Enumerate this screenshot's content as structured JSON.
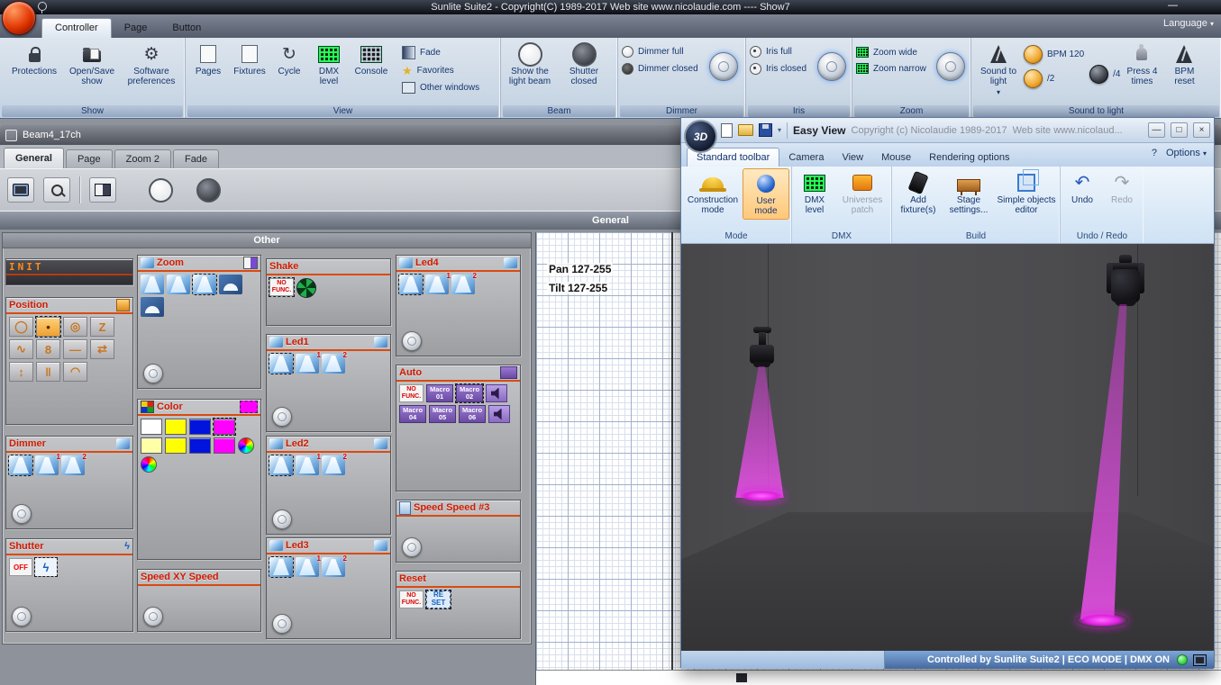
{
  "icons": {
    "minimize": "—",
    "maximize": "□",
    "close": "×",
    "gear": "⚙",
    "cycle": "↻",
    "star": "★",
    "undo_arrow": "↶",
    "redo_arrow": "↷",
    "chevron": "▾",
    "help": "?"
  },
  "colors": {
    "accent_magenta": "#ff00ff",
    "beam_magenta": "#e020e0",
    "status_green": "#2ecc3e"
  },
  "titlebar": {
    "title": "Sunlite Suite2 - Copyright(C) 1989-2017    Web site www.nicolaudie.com ---- Show7"
  },
  "ribbon": {
    "tabs": [
      {
        "label": "Controller"
      },
      {
        "label": "Page"
      },
      {
        "label": "Button"
      }
    ],
    "language": "Language",
    "groups": {
      "show": {
        "label": "Show",
        "protections": "Protections",
        "open_save": "Open/Save show",
        "preferences": "Software preferences"
      },
      "view": {
        "label": "View",
        "pages": "Pages",
        "fixtures": "Fixtures",
        "cycle": "Cycle",
        "dmx_level": "DMX level",
        "console": "Console",
        "fade": "Fade",
        "favorites": "Favorites",
        "other_windows": "Other windows"
      },
      "beam": {
        "label": "Beam",
        "show_beam": "Show the light beam",
        "shutter_closed": "Shutter closed"
      },
      "dimmer": {
        "label": "Dimmer",
        "full": "Dimmer full",
        "closed": "Dimmer closed"
      },
      "iris": {
        "label": "Iris",
        "full": "Iris full",
        "closed": "Iris closed"
      },
      "zoom": {
        "label": "Zoom",
        "wide": "Zoom wide",
        "narrow": "Zoom narrow"
      },
      "sound": {
        "label": "Sound to light",
        "main": "Sound to light",
        "bpm": "BPM 120",
        "div2": "/2",
        "div4": "/4",
        "press": "Press 4 times",
        "reset": "BPM reset"
      }
    }
  },
  "beam_window": {
    "title": "Beam4_17ch",
    "tabs": [
      {
        "label": "General"
      },
      {
        "label": "Page"
      },
      {
        "label": "Zoom 2"
      },
      {
        "label": "Fade"
      }
    ],
    "section": "General",
    "panel": "Other",
    "groups": {
      "init": {
        "title": "INIT"
      },
      "position": {
        "title": "Position",
        "icons": [
          {
            "type": "glyphbtn",
            "char": "◯",
            "name": "circle-pattern-icon"
          },
          {
            "type": "glyphbtn",
            "char": "•",
            "sel": true,
            "name": "center-pattern-icon"
          },
          {
            "type": "glyphbtn",
            "char": "◎",
            "name": "spiral-pattern-icon"
          },
          {
            "type": "glyphbtn",
            "char": "Z",
            "name": "zigzag-pattern-icon"
          },
          {
            "type": "glyphbtn",
            "char": "∿",
            "name": "wave-pattern-icon"
          },
          {
            "type": "glyphbtn",
            "char": "8",
            "name": "eight-pattern-icon"
          },
          {
            "type": "glyphbtn",
            "char": "—",
            "name": "line-pattern-icon"
          },
          {
            "type": "glyphbtn",
            "char": "⇄",
            "name": "pan-sweep-pattern-icon"
          },
          {
            "type": "glyphbtn",
            "char": "↕",
            "name": "tilt-sweep-pattern-icon"
          },
          {
            "type": "glyphbtn",
            "char": "‖",
            "name": "pause-pattern-icon"
          },
          {
            "type": "glyphbtn",
            "char": "◠",
            "name": "arc-pattern-icon"
          }
        ]
      },
      "dimmer": {
        "title": "Dimmer",
        "icons": [
          {
            "type": "beam",
            "sel": true
          },
          {
            "type": "beam",
            "badge": "1"
          },
          {
            "type": "beam",
            "badge": "2"
          }
        ]
      },
      "shutter": {
        "title": "Shutter",
        "icons": [
          {
            "type": "off",
            "label": "OFF"
          },
          {
            "type": "bolt",
            "char": "ϟ",
            "sel": true
          }
        ]
      },
      "zoom": {
        "title": "Zoom",
        "icons": [
          {
            "type": "beam"
          },
          {
            "type": "beam"
          },
          {
            "type": "beam",
            "sel": true
          },
          {
            "type": "half"
          },
          {
            "type": "half"
          }
        ]
      },
      "color": {
        "title": "Color",
        "selected_color": "#ff00ff",
        "icons": [
          {
            "type": "swatch",
            "color": "#ffffff"
          },
          {
            "type": "swatch",
            "color": "#ffff00"
          },
          {
            "type": "swatch",
            "color": "#0014dd"
          },
          {
            "type": "swatch",
            "color": "#ff00ff",
            "sel": true
          },
          {
            "type": "swatch",
            "color": "#ffffa8"
          },
          {
            "type": "swatch",
            "color": "#ffff00"
          },
          {
            "type": "swatch",
            "color": "#0014dd"
          },
          {
            "type": "swatch",
            "color": "#ff00ff"
          },
          {
            "type": "wheel"
          },
          {
            "type": "wheel"
          }
        ]
      },
      "speed_xy": {
        "title": "Speed XY Speed"
      },
      "shake": {
        "title": "Shake",
        "icons": [
          {
            "type": "nofunc",
            "label": "NO FUNC.",
            "sel": true
          },
          {
            "type": "radar"
          }
        ]
      },
      "led1": {
        "title": "Led1",
        "icons": [
          {
            "type": "beam",
            "sel": true
          },
          {
            "type": "beam",
            "badge": "1"
          },
          {
            "type": "beam",
            "badge": "2"
          }
        ]
      },
      "led2": {
        "title": "Led2",
        "icons": [
          {
            "type": "beam",
            "sel": true
          },
          {
            "type": "beam",
            "badge": "1"
          },
          {
            "type": "beam",
            "badge": "2"
          }
        ]
      },
      "led3": {
        "title": "Led3",
        "icons": [
          {
            "type": "beam",
            "sel": true
          },
          {
            "type": "beam",
            "badge": "1"
          },
          {
            "type": "beam",
            "badge": "2"
          }
        ]
      },
      "led4": {
        "title": "Led4",
        "icons": [
          {
            "type": "beam",
            "sel": true
          },
          {
            "type": "beam",
            "badge": "1"
          },
          {
            "type": "beam",
            "badge": "2"
          }
        ]
      },
      "auto": {
        "title": "Auto",
        "icons": [
          {
            "type": "nofunc",
            "label": "NO FUNC."
          },
          {
            "type": "macro",
            "label": "Macro 01"
          },
          {
            "type": "macro",
            "label": "Macro 02",
            "sel": true
          },
          {
            "type": "speaker"
          },
          {
            "type": "macro",
            "label": "Macro 04"
          },
          {
            "type": "macro",
            "label": "Macro 05"
          },
          {
            "type": "macro",
            "label": "Macro 06"
          },
          {
            "type": "speaker"
          }
        ]
      },
      "speed3": {
        "title": "Speed Speed #3"
      },
      "reset": {
        "title": "Reset",
        "icons": [
          {
            "type": "nofunc",
            "label": "NO FUNC."
          },
          {
            "type": "reset",
            "label": "RE SET",
            "sel": true
          }
        ]
      }
    }
  },
  "grid_panel": {
    "pan": "Pan 127-255",
    "tilt": "Tilt 127-255"
  },
  "easy_view": {
    "logo": "3D",
    "title": "Easy View",
    "copyright": "Copyright (c) Nicolaudie 1989-2017",
    "website": "Web site www.nicolaud...",
    "tabs": [
      {
        "label": "Standard toolbar"
      },
      {
        "label": "Camera"
      },
      {
        "label": "View"
      },
      {
        "label": "Mouse"
      },
      {
        "label": "Rendering options"
      }
    ],
    "help": "?",
    "options": "Options",
    "mode": {
      "label": "Mode",
      "construction": "Construction mode",
      "user": "User mode"
    },
    "dmx": {
      "label": "DMX",
      "level": "DMX level",
      "patch": "Universes patch"
    },
    "build": {
      "label": "Build",
      "add": "Add fixture(s)",
      "stage": "Stage settings...",
      "objects": "Simple objects editor"
    },
    "undo": {
      "label": "Undo / Redo",
      "undo": "Undo",
      "redo": "Redo"
    },
    "status": "Controlled by Sunlite Suite2  |  ECO MODE  |  DMX ON"
  }
}
